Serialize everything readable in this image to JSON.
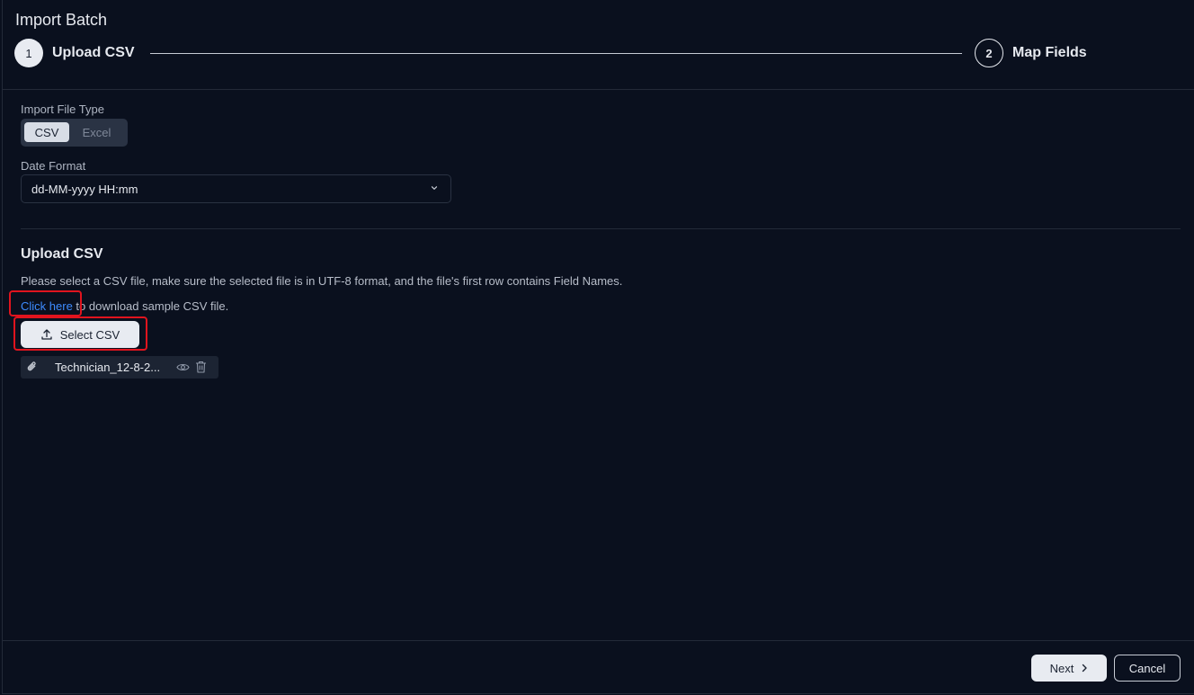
{
  "window": {
    "title": "Import Batch"
  },
  "stepper": {
    "steps": [
      {
        "number": "1",
        "label": "Upload CSV",
        "state": "active"
      },
      {
        "number": "2",
        "label": "Map Fields",
        "state": "pending"
      }
    ]
  },
  "import_file_type": {
    "label": "Import File Type",
    "options": [
      "CSV",
      "Excel"
    ],
    "selected": "CSV"
  },
  "date_format": {
    "label": "Date Format",
    "value": "dd-MM-yyyy HH:mm",
    "icon": "chevron-down-icon"
  },
  "upload": {
    "title": "Upload CSV",
    "description": "Please select a CSV file, make sure the selected file is in UTF-8 format, and the file's first row contains Field Names.",
    "download_link": "Click here",
    "download_suffix": " to download sample CSV file.",
    "select_button": "Select CSV",
    "select_icon": "upload-icon",
    "file": {
      "name": "Technician_12-8-2...",
      "icons": [
        "paperclip-icon",
        "eye-icon",
        "trash-icon"
      ]
    }
  },
  "footer": {
    "next_label": "Next",
    "cancel_label": "Cancel"
  },
  "colors": {
    "background": "#0a101e",
    "link": "#3d8bff",
    "highlight": "#e0141e",
    "button_fill": "#e8ebf1"
  }
}
